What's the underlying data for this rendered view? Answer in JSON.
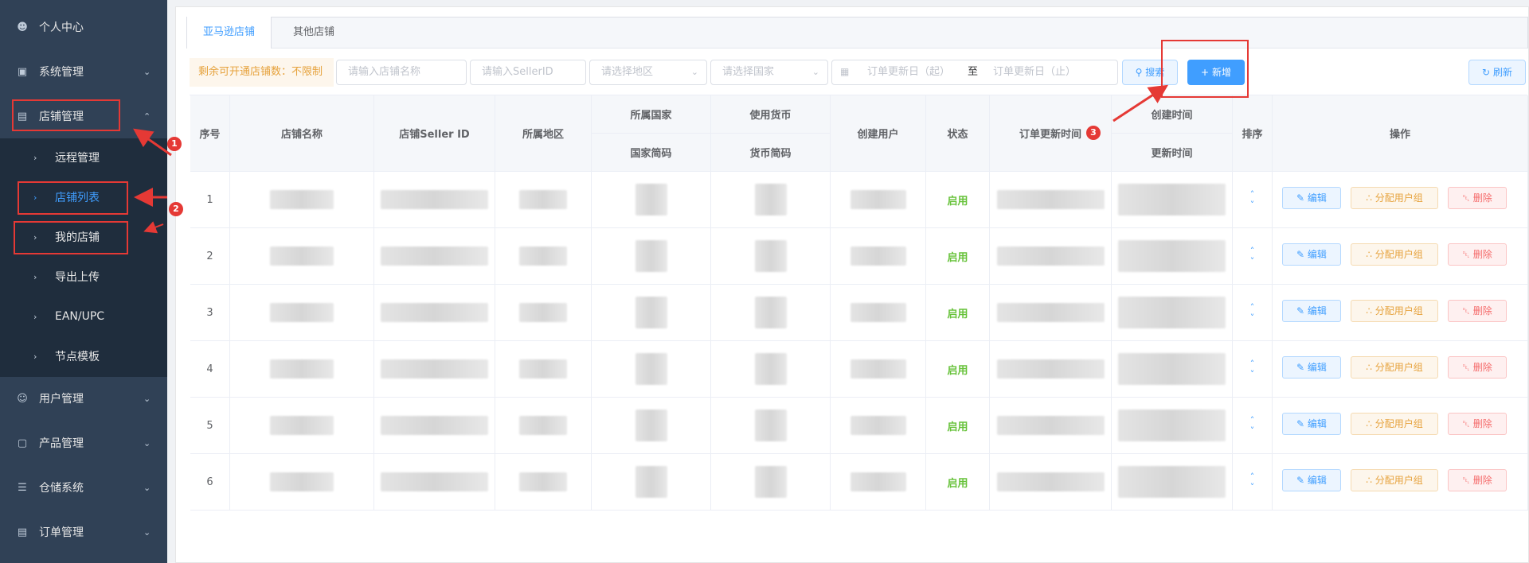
{
  "sidebar": {
    "items": [
      {
        "label": "个人中心",
        "icon": "user-icon"
      },
      {
        "label": "系统管理",
        "icon": "monitor-icon"
      },
      {
        "label": "店铺管理",
        "icon": "store-icon"
      },
      {
        "label": "用户管理",
        "icon": "users-icon"
      },
      {
        "label": "产品管理",
        "icon": "bag-icon"
      },
      {
        "label": "仓储系统",
        "icon": "list-icon"
      },
      {
        "label": "订单管理",
        "icon": "document-icon"
      }
    ],
    "sub_items": [
      {
        "label": "远程管理"
      },
      {
        "label": "店铺列表"
      },
      {
        "label": "我的店铺"
      },
      {
        "label": "导出上传"
      },
      {
        "label": "EAN/UPC"
      },
      {
        "label": "节点模板"
      }
    ]
  },
  "tabs": [
    {
      "label": "亚马逊店铺"
    },
    {
      "label": "其他店铺"
    }
  ],
  "toolbar": {
    "tip": "剩余可开通店铺数：不限制",
    "store_name_placeholder": "请输入店铺名称",
    "seller_id_placeholder": "请输入SellerID",
    "region_placeholder": "请选择地区",
    "country_placeholder": "请选择国家",
    "date_start_placeholder": "订单更新日（起）",
    "date_sep": "至",
    "date_end_placeholder": "订单更新日（止）",
    "search_label": "搜索",
    "add_label": "新增",
    "refresh_label": "刷新"
  },
  "table": {
    "headers": {
      "index": "序号",
      "store_name": "店铺名称",
      "seller_id": "店铺Seller ID",
      "region": "所属地区",
      "country": "所属国家",
      "country_code": "国家简码",
      "currency": "使用货币",
      "currency_code": "货币简码",
      "creator": "创建用户",
      "status": "状态",
      "order_update_time": "订单更新时间",
      "create_time": "创建时间",
      "update_time": "更新时间",
      "sort": "排序",
      "actions": "操作"
    },
    "rows": [
      {
        "index": "1",
        "status": "启用"
      },
      {
        "index": "2",
        "status": "启用"
      },
      {
        "index": "3",
        "status": "启用"
      },
      {
        "index": "4",
        "status": "启用"
      },
      {
        "index": "5",
        "status": "启用"
      },
      {
        "index": "6",
        "status": "启用"
      }
    ],
    "actions": {
      "edit": "编辑",
      "assign": "分配用户组",
      "delete": "删除"
    }
  },
  "annotations": [
    {
      "number": "1"
    },
    {
      "number": "2"
    },
    {
      "number": "3"
    }
  ],
  "colors": {
    "sidebar_bg": "#304156",
    "accent": "#409eff",
    "status_green": "#67c23a",
    "annotation_red": "#e53935"
  }
}
